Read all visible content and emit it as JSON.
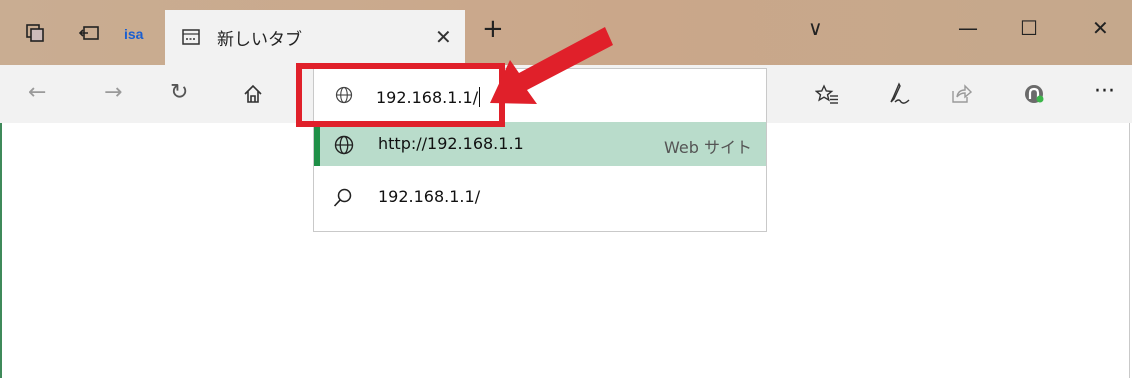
{
  "tab": {
    "title": "新しいタブ",
    "close": "✕"
  },
  "newtab": "+",
  "window": {
    "menu": "∨",
    "minimize": "—",
    "maximize": "☐",
    "close": "✕"
  },
  "toolbar": {
    "back": "←",
    "forward": "→",
    "refresh": "↻",
    "more": "···"
  },
  "address": {
    "value": "192.168.1.1/"
  },
  "suggestions": [
    {
      "text": "http://192.168.1.1",
      "meta": "Web サイト",
      "icon": "globe-icon"
    },
    {
      "text": "192.168.1.1/",
      "meta": "",
      "icon": "search-icon"
    }
  ],
  "colors": {
    "highlight": "#e0202a",
    "selected": "#b9dccb",
    "accent": "#1f8f47"
  }
}
